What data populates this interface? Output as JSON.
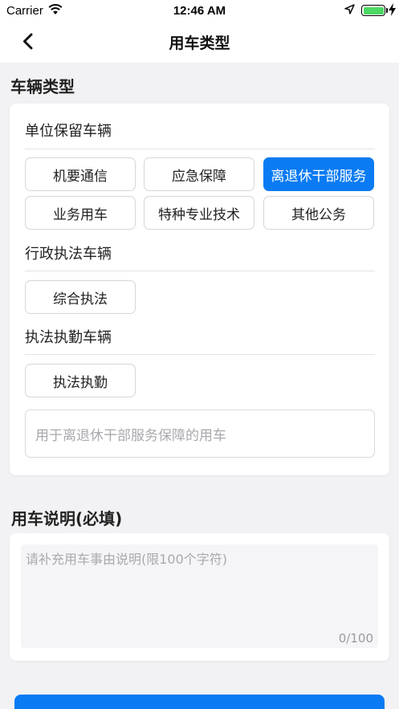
{
  "status_bar": {
    "carrier": "Carrier",
    "time": "12:46 AM",
    "icons": [
      "wifi-icon",
      "location-arrow-icon",
      "battery-icon",
      "charging-bolt-icon"
    ],
    "battery_color": "#4cd964"
  },
  "nav": {
    "title": "用车类型",
    "back_icon": "chevron-left-icon"
  },
  "vehicle_type": {
    "section_title": "车辆类型",
    "groups": [
      {
        "title": "单位保留车辆",
        "options": [
          "机要通信",
          "应急保障",
          "离退休干部服务",
          "业务用车",
          "特种专业技术",
          "其他公务"
        ]
      },
      {
        "title": "行政执法车辆",
        "options": [
          "综合执法"
        ]
      },
      {
        "title": "执法执勤车辆",
        "options": [
          "执法执勤"
        ]
      }
    ],
    "selected_option": "离退休干部服务",
    "description": "用于离退休干部服务保障的用车"
  },
  "usage_note": {
    "section_title": "用车说明(必填)",
    "placeholder": "请补充用车事由说明(限100个字符)",
    "counter": "0/100"
  },
  "colors": {
    "accent": "#0a7bf3",
    "background": "#f2f2f5",
    "card": "#ffffff"
  }
}
